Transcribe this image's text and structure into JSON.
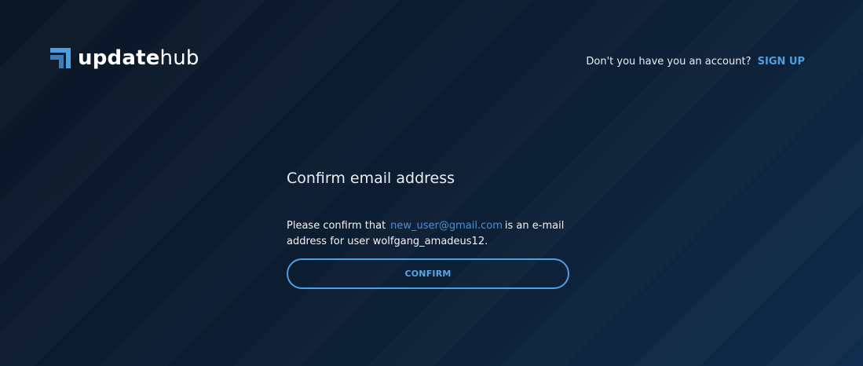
{
  "header": {
    "logo": {
      "bold_part": "update",
      "light_part": "hub",
      "icon": "updatehub-logo-icon"
    },
    "account_prompt": "Don't you have you an account?",
    "signup_label": "SIGN UP"
  },
  "confirm": {
    "title": "Confirm email address",
    "text_before": "Please confirm that",
    "email": "new_user@gmail.com",
    "text_after": "is an e-mail address for user wolfgang_amadeus12.",
    "button_label": "CONFIRM"
  },
  "colors": {
    "accent": "#4f9ee0",
    "background": "#0b1b2e"
  }
}
